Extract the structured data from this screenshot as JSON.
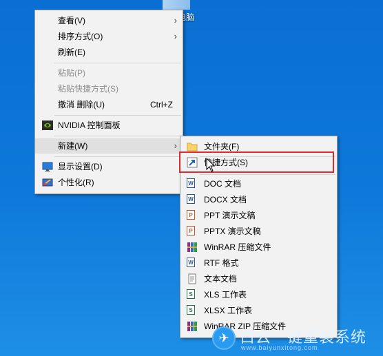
{
  "desktop": {
    "icon_label": "电脑"
  },
  "context_menu": {
    "items": [
      {
        "label": "查看(V)",
        "has_submenu": true
      },
      {
        "label": "排序方式(O)",
        "has_submenu": true
      },
      {
        "label": "刷新(E)"
      },
      {
        "label": "粘贴(P)",
        "disabled": true
      },
      {
        "label": "粘贴快捷方式(S)",
        "disabled": true
      },
      {
        "label": "撤消 删除(U)",
        "shortcut": "Ctrl+Z"
      },
      {
        "label": "NVIDIA 控制面板",
        "icon": "nvidia-icon"
      },
      {
        "label": "新建(W)",
        "has_submenu": true,
        "hover": true
      },
      {
        "label": "显示设置(D)",
        "icon": "display-settings-icon"
      },
      {
        "label": "个性化(R)",
        "icon": "personalize-icon"
      }
    ]
  },
  "new_submenu": {
    "items": [
      {
        "label": "文件夹(F)",
        "icon": "folder-icon"
      },
      {
        "label": "快捷方式(S)",
        "icon": "shortcut-icon",
        "highlighted": true
      },
      {
        "label": "DOC 文档",
        "icon": "word-icon"
      },
      {
        "label": "DOCX 文档",
        "icon": "word-icon"
      },
      {
        "label": "PPT 演示文稿",
        "icon": "powerpoint-icon"
      },
      {
        "label": "PPTX 演示文稿",
        "icon": "powerpoint-icon"
      },
      {
        "label": "WinRAR 压缩文件",
        "icon": "winrar-icon"
      },
      {
        "label": "RTF 格式",
        "icon": "rtf-icon"
      },
      {
        "label": "文本文档",
        "icon": "text-file-icon"
      },
      {
        "label": "XLS 工作表",
        "icon": "excel-icon"
      },
      {
        "label": "XLSX 工作表",
        "icon": "excel-icon"
      },
      {
        "label": "WinRAR ZIP 压缩文件",
        "icon": "winrar-zip-icon"
      }
    ]
  },
  "watermark": {
    "title": "白云一键重装系统",
    "url": "www.baiyunxitong.com"
  },
  "colors": {
    "highlight_border": "#e0282d",
    "menu_bg": "#f2f2f2",
    "desktop_bg": "#0e79da"
  }
}
